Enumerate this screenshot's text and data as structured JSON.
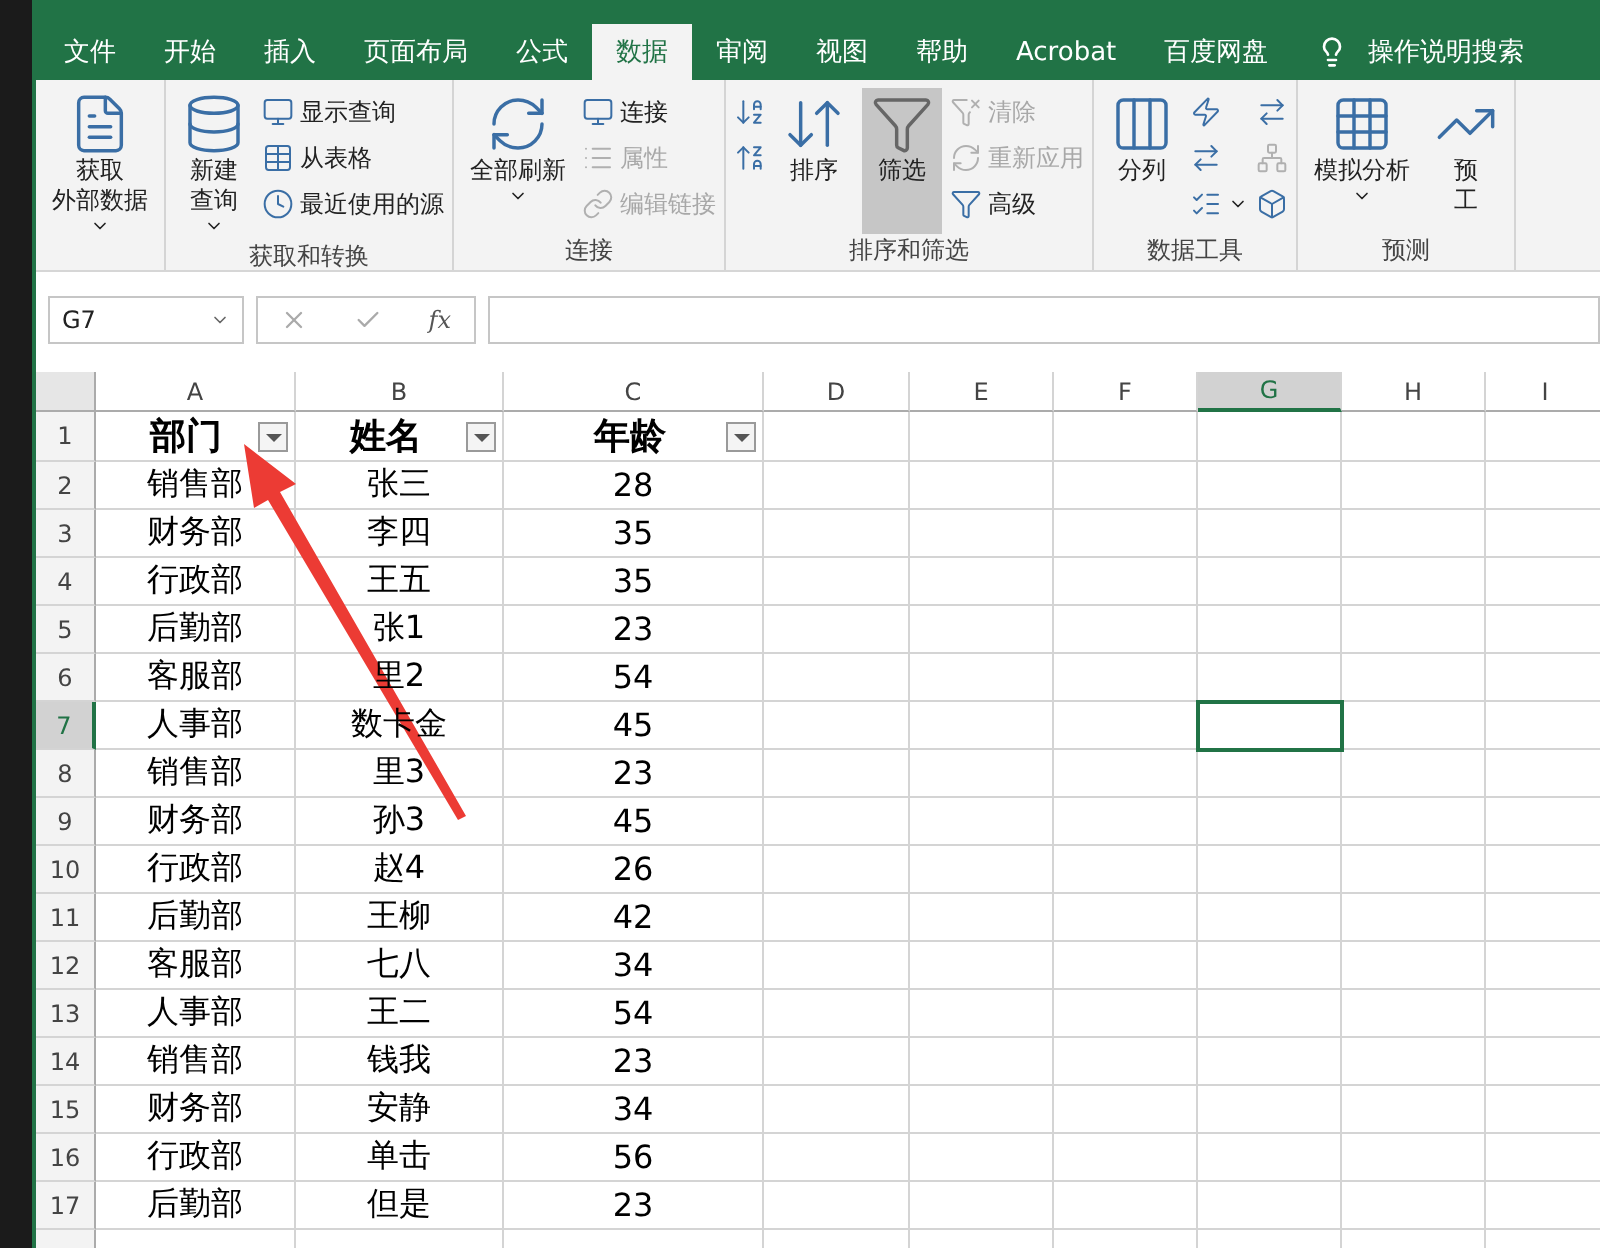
{
  "tabs": [
    {
      "label": "文件",
      "selected": false
    },
    {
      "label": "开始",
      "selected": false
    },
    {
      "label": "插入",
      "selected": false
    },
    {
      "label": "页面布局",
      "selected": false
    },
    {
      "label": "公式",
      "selected": false
    },
    {
      "label": "数据",
      "selected": true
    },
    {
      "label": "审阅",
      "selected": false
    },
    {
      "label": "视图",
      "selected": false
    },
    {
      "label": "帮助",
      "selected": false
    },
    {
      "label": "Acrobat",
      "selected": false
    },
    {
      "label": "百度网盘",
      "selected": false
    }
  ],
  "tell_me": "操作说明搜索",
  "ribbon": [
    {
      "columns": [
        {
          "kind": "large",
          "label": [
            "获取",
            "外部数据"
          ],
          "dropdown": true,
          "on": false
        }
      ]
    },
    {
      "label": "获取和转换",
      "columns": [
        {
          "kind": "large",
          "label": [
            "新建",
            "查询"
          ],
          "dropdown": true,
          "on": false
        },
        {
          "kind": "stack",
          "items": [
            {
              "label": "显示查询",
              "disabled": false
            },
            {
              "label": "从表格",
              "disabled": false
            },
            {
              "label": "最近使用的源",
              "disabled": false
            }
          ]
        }
      ]
    },
    {
      "label": "连接",
      "columns": [
        {
          "kind": "large",
          "label": [
            "全部刷新"
          ],
          "dropdown": true,
          "on": false
        },
        {
          "kind": "stack",
          "items": [
            {
              "label": "连接",
              "disabled": false
            },
            {
              "label": "属性",
              "disabled": true
            },
            {
              "label": "编辑链接",
              "disabled": true
            }
          ]
        }
      ]
    },
    {
      "label": "排序和筛选",
      "columns": [
        {
          "kind": "stack",
          "items": [
            {
              "disabled": false
            },
            {
              "disabled": false
            }
          ]
        },
        {
          "kind": "large",
          "label": [
            "排序"
          ],
          "dropdown": false,
          "on": false
        },
        {
          "kind": "large",
          "label": [
            "筛选"
          ],
          "dropdown": false,
          "on": true
        },
        {
          "kind": "stack",
          "items": [
            {
              "label": "清除",
              "disabled": true
            },
            {
              "label": "重新应用",
              "disabled": true
            },
            {
              "label": "高级",
              "disabled": false
            }
          ]
        }
      ]
    },
    {
      "label": "数据工具",
      "columns": [
        {
          "kind": "large",
          "label": [
            "分列"
          ],
          "dropdown": false,
          "on": false
        },
        {
          "kind": "stack",
          "items": [
            {
              "disabled": false
            },
            {
              "disabled": false
            },
            {
              "disabled": false,
              "dropdown": true
            }
          ]
        },
        {
          "kind": "stack",
          "items": [
            {
              "disabled": false
            },
            {
              "disabled": true
            },
            {
              "disabled": false
            }
          ]
        }
      ]
    },
    {
      "label": "预测",
      "columns": [
        {
          "kind": "large",
          "label": [
            "模拟分析"
          ],
          "dropdown": true,
          "on": false
        },
        {
          "kind": "large",
          "label": [
            "预",
            "工"
          ],
          "dropdown": false,
          "on": false
        }
      ]
    }
  ],
  "formula_bar": {
    "name_box": "G7",
    "function_label": "fx"
  },
  "sheet": {
    "columns": [
      {
        "label": "A",
        "selected": false
      },
      {
        "label": "B",
        "selected": false
      },
      {
        "label": "C",
        "selected": false
      },
      {
        "label": "D",
        "selected": false
      },
      {
        "label": "E",
        "selected": false
      },
      {
        "label": "F",
        "selected": false
      },
      {
        "label": "G",
        "selected": true
      },
      {
        "label": "H",
        "selected": false
      },
      {
        "label": "I",
        "selected": false
      }
    ],
    "rows": [
      {
        "number": "1",
        "kind": "header",
        "selected": false,
        "cells": [
          "部门",
          "姓名",
          "年龄"
        ]
      },
      {
        "number": "2",
        "kind": "data",
        "selected": false,
        "cells": [
          "销售部",
          "张三",
          "28"
        ]
      },
      {
        "number": "3",
        "kind": "data",
        "selected": false,
        "cells": [
          "财务部",
          "李四",
          "35"
        ]
      },
      {
        "number": "4",
        "kind": "data",
        "selected": false,
        "cells": [
          "行政部",
          "王五",
          "35"
        ]
      },
      {
        "number": "5",
        "kind": "data",
        "selected": false,
        "cells": [
          "后勤部",
          "张1",
          "23"
        ]
      },
      {
        "number": "6",
        "kind": "data",
        "selected": false,
        "cells": [
          "客服部",
          "里2",
          "54"
        ]
      },
      {
        "number": "7",
        "kind": "data",
        "selected": true,
        "cells": [
          "人事部",
          "数卡金",
          "45"
        ]
      },
      {
        "number": "8",
        "kind": "data",
        "selected": false,
        "cells": [
          "销售部",
          "里3",
          "23"
        ]
      },
      {
        "number": "9",
        "kind": "data",
        "selected": false,
        "cells": [
          "财务部",
          "孙3",
          "45"
        ]
      },
      {
        "number": "10",
        "kind": "data",
        "selected": false,
        "cells": [
          "行政部",
          "赵4",
          "26"
        ]
      },
      {
        "number": "11",
        "kind": "data",
        "selected": false,
        "cells": [
          "后勤部",
          "王柳",
          "42"
        ]
      },
      {
        "number": "12",
        "kind": "data",
        "selected": false,
        "cells": [
          "客服部",
          "七八",
          "34"
        ]
      },
      {
        "number": "13",
        "kind": "data",
        "selected": false,
        "cells": [
          "人事部",
          "王二",
          "54"
        ]
      },
      {
        "number": "14",
        "kind": "data",
        "selected": false,
        "cells": [
          "销售部",
          "钱我",
          "23"
        ]
      },
      {
        "number": "15",
        "kind": "data",
        "selected": false,
        "cells": [
          "财务部",
          "安静",
          "34"
        ]
      },
      {
        "number": "16",
        "kind": "data",
        "selected": false,
        "cells": [
          "行政部",
          "单击",
          "56"
        ]
      },
      {
        "number": "17",
        "kind": "data",
        "selected": false,
        "cells": [
          "后勤部",
          "但是",
          "23"
        ]
      }
    ]
  }
}
